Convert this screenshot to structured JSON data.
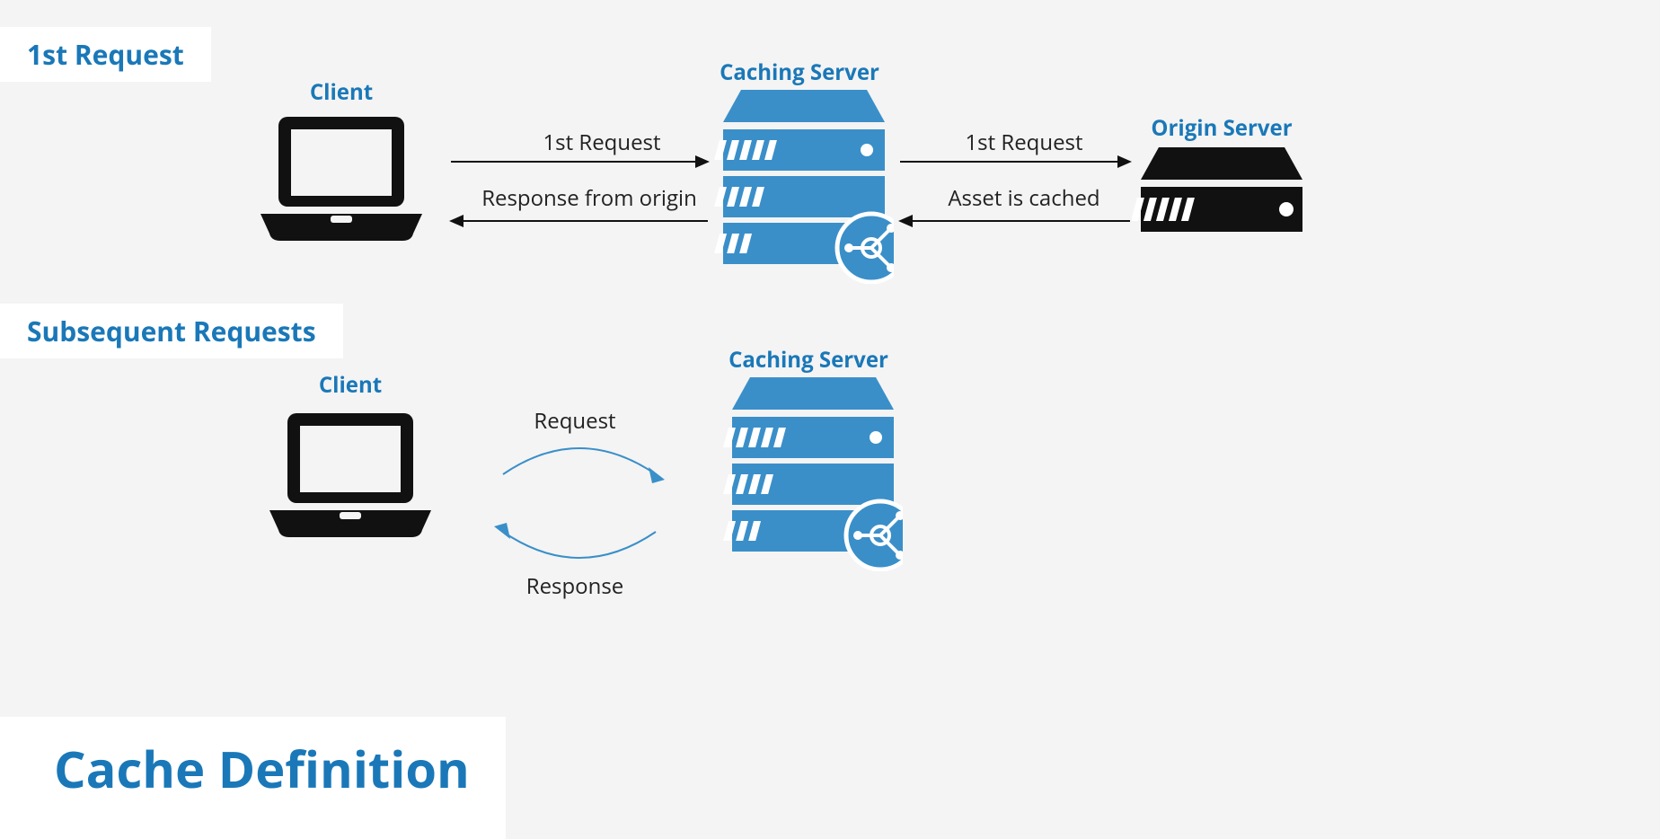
{
  "sections": {
    "first": "1st Request",
    "subsequent": "Subsequent Requests"
  },
  "title": "Cache Definition",
  "labels": {
    "client1": "Client",
    "caching1": "Caching Server",
    "origin": "Origin Server",
    "client2": "Client",
    "caching2": "Caching Server"
  },
  "arrows": {
    "top": {
      "client_to_cache_top": "1st Request",
      "cache_to_client_bottom": "Response from origin",
      "cache_to_origin_top": "1st Request",
      "origin_to_cache_bottom": "Asset is cached"
    },
    "bottom": {
      "request": "Request",
      "response": "Response"
    }
  },
  "colors": {
    "blue": "#1a78b8",
    "accent": "#3a8fc9",
    "black": "#111111",
    "bg": "#f4f4f4"
  }
}
